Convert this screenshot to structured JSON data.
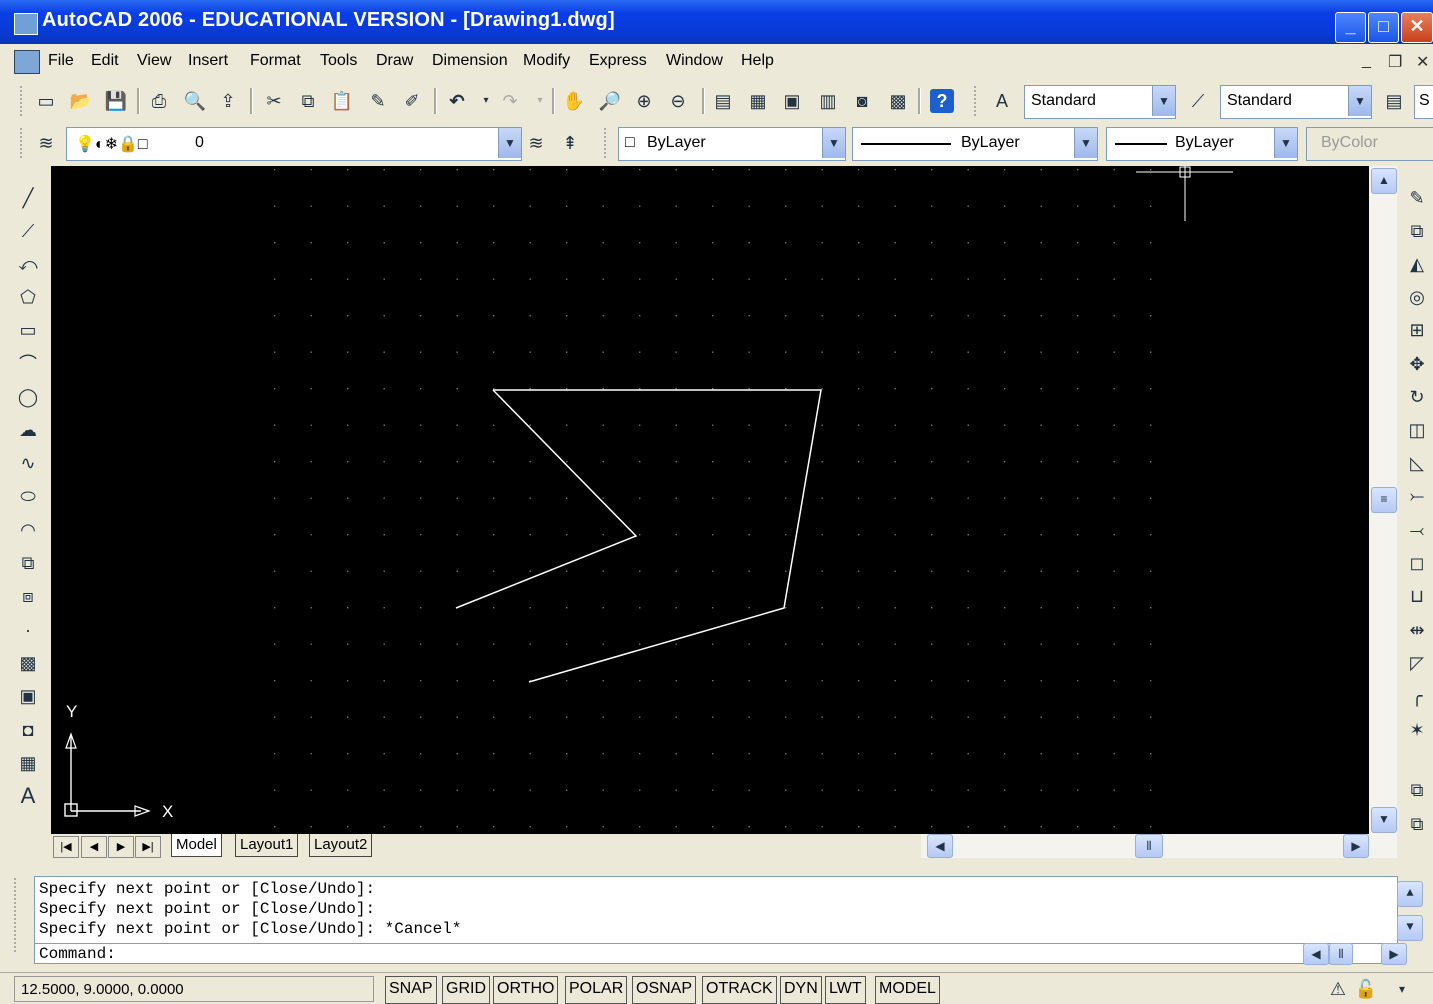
{
  "window": {
    "title": "AutoCAD 2006 - EDUCATIONAL VERSION - [Drawing1.dwg]"
  },
  "menu": [
    "File",
    "Edit",
    "View",
    "Insert",
    "Format",
    "Tools",
    "Draw",
    "Dimension",
    "Modify",
    "Express",
    "Window",
    "Help"
  ],
  "styles": {
    "text_style": "Standard",
    "dim_style": "Standard",
    "table_style_partial": "S"
  },
  "layers": {
    "current_layer": "0",
    "color": "ByLayer",
    "linetype": "ByLayer",
    "lineweight": "ByLayer",
    "plotstyle": "ByColor"
  },
  "tabs": [
    "Model",
    "Layout1",
    "Layout2"
  ],
  "ucs": {
    "x": "X",
    "y": "Y"
  },
  "command": {
    "history": [
      "Specify next point or [Close/Undo]:",
      "Specify next point or [Close/Undo]:",
      "Specify next point or [Close/Undo]: *Cancel*"
    ],
    "prompt": "Command:"
  },
  "status": {
    "coords": "12.5000, 9.0000, 0.0000",
    "toggles": [
      "SNAP",
      "GRID",
      "ORTHO",
      "POLAR",
      "OSNAP",
      "OTRACK",
      "DYN",
      "LWT",
      "MODEL"
    ]
  },
  "colors": {
    "title_blue": "#0a3ee6",
    "canvas": "#000000",
    "chrome": "#ece9d8"
  }
}
